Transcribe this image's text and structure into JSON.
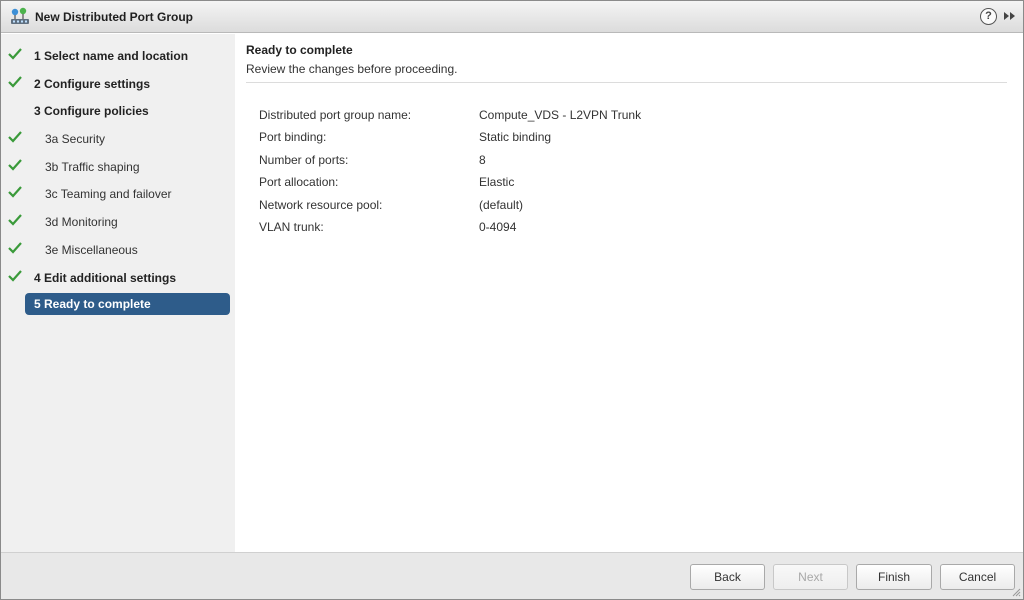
{
  "window": {
    "title": "New Distributed Port Group",
    "help_glyph": "?",
    "title_icon": "distributed-port-group-icon"
  },
  "sidebar": {
    "steps": [
      {
        "label": "1  Select name and location",
        "checked": true,
        "bold": true,
        "level": "top"
      },
      {
        "label": "2  Configure settings",
        "checked": true,
        "bold": true,
        "level": "top"
      },
      {
        "label": "3  Configure policies",
        "checked": false,
        "bold": true,
        "level": "top"
      },
      {
        "label": "3a  Security",
        "checked": true,
        "bold": false,
        "level": "sub"
      },
      {
        "label": "3b  Traffic shaping",
        "checked": true,
        "bold": false,
        "level": "sub"
      },
      {
        "label": "3c  Teaming and failover",
        "checked": true,
        "bold": false,
        "level": "sub"
      },
      {
        "label": "3d  Monitoring",
        "checked": true,
        "bold": false,
        "level": "sub"
      },
      {
        "label": "3e  Miscellaneous",
        "checked": true,
        "bold": false,
        "level": "sub"
      },
      {
        "label": "4  Edit additional settings",
        "checked": true,
        "bold": true,
        "level": "top"
      },
      {
        "label": "5  Ready to complete",
        "checked": false,
        "bold": true,
        "level": "top",
        "active": true
      }
    ],
    "check_color": "#3a9a3a",
    "active_color": "#2e5c8a"
  },
  "main": {
    "title": "Ready to complete",
    "subtitle": "Review the changes before proceeding.",
    "summary": [
      {
        "key": "Distributed port group name:",
        "value": "Compute_VDS - L2VPN Trunk"
      },
      {
        "key": "Port binding:",
        "value": "Static binding"
      },
      {
        "key": "Number of ports:",
        "value": "8"
      },
      {
        "key": "Port allocation:",
        "value": "Elastic"
      },
      {
        "key": "Network resource pool:",
        "value": "(default)"
      },
      {
        "key": "VLAN trunk:",
        "value": "0-4094"
      }
    ]
  },
  "footer": {
    "back_label": "Back",
    "next_label": "Next",
    "finish_label": "Finish",
    "cancel_label": "Cancel"
  }
}
